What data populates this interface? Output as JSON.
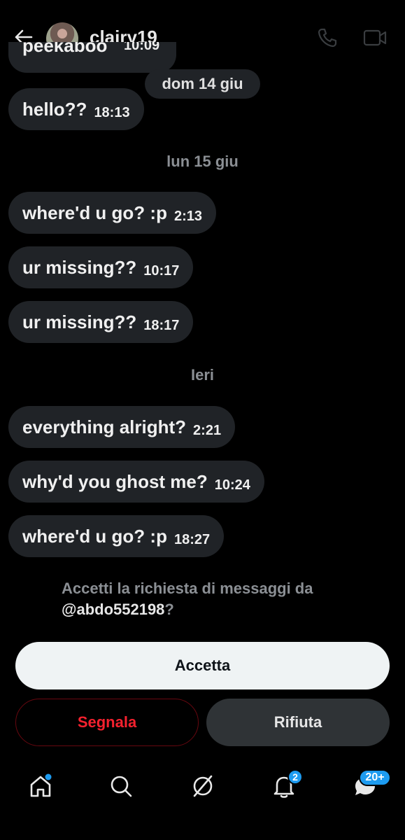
{
  "header": {
    "title": "clairy19"
  },
  "clipped_message": {
    "text": "peekaboo",
    "time": "10:09"
  },
  "date_pill": "dom 14 giu",
  "dates": {
    "lun": "lun 15 giu",
    "ieri": "Ieri"
  },
  "messages": [
    {
      "text": "hello??",
      "time": "18:13"
    },
    {
      "text": "where'd u go? :p",
      "time": "2:13"
    },
    {
      "text": "ur missing??",
      "time": "10:17"
    },
    {
      "text": "ur missing??",
      "time": "18:17"
    },
    {
      "text": "everything alright?",
      "time": "2:21"
    },
    {
      "text": "why'd you ghost me?",
      "time": "10:24"
    },
    {
      "text": "where'd u go? :p",
      "time": "18:27"
    }
  ],
  "request": {
    "prompt": "Accetti la richiesta di messaggi da",
    "handle": "@abdo552198",
    "suffix": "?"
  },
  "buttons": {
    "accept": "Accetta",
    "report": "Segnala",
    "decline": "Rifiuta"
  },
  "nav": {
    "notifications_badge": "2",
    "messages_badge": "20+"
  },
  "colors": {
    "background": "#000000",
    "bubble": "#202327",
    "accent": "#1d9bf0",
    "danger": "#f4212e"
  },
  "icons": [
    "back-arrow-icon",
    "phone-icon",
    "video-call-icon",
    "home-icon",
    "search-icon",
    "grok-icon",
    "bell-icon",
    "messages-icon"
  ]
}
